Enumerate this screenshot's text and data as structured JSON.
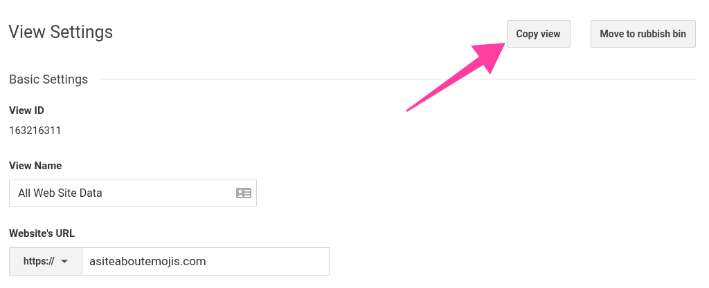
{
  "title": "View Settings",
  "buttons": [
    "Copy view",
    "Move to rubbish bin"
  ],
  "section": {
    "title": "Basic Settings"
  },
  "view_id": {
    "label": "View ID",
    "value": "163216311"
  },
  "view_name": {
    "label": "View Name",
    "value": "All Web Site Data"
  },
  "website_url": {
    "label": "Website's URL",
    "protocol": "https://",
    "value": "asiteaboutemojis.com"
  }
}
